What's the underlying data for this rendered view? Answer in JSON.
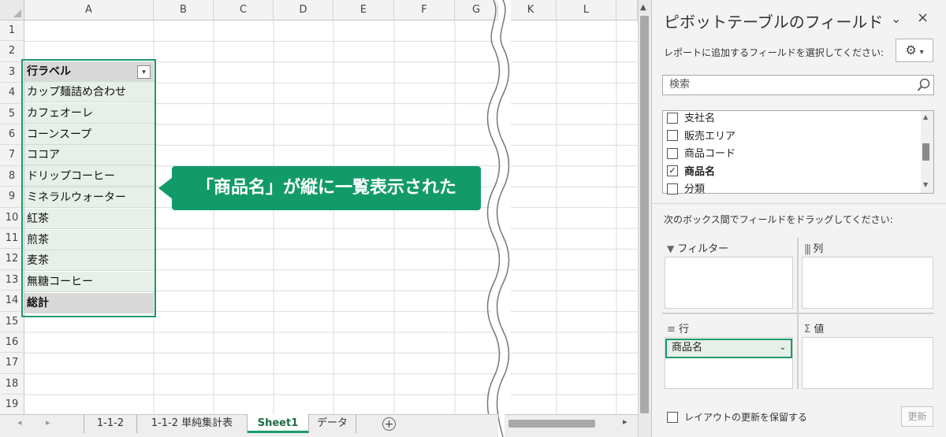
{
  "spreadsheet": {
    "columns": [
      "A",
      "B",
      "C",
      "D",
      "E",
      "F",
      "G",
      "K",
      "L"
    ],
    "rows": [
      "1",
      "2",
      "3",
      "4",
      "5",
      "6",
      "7",
      "8",
      "9",
      "10",
      "11",
      "12",
      "13",
      "14",
      "15",
      "16",
      "17",
      "18",
      "19"
    ],
    "pivot": {
      "header": "行ラベル",
      "items": [
        "カップ麺詰め合わせ",
        "カフェオーレ",
        "コーンスープ",
        "ココア",
        "ドリップコーヒー",
        "ミネラルウォーター",
        "紅茶",
        "煎茶",
        "麦茶",
        "無糖コーヒー"
      ],
      "total": "総計"
    },
    "callout": "「商品名」が縦に一覧表示された"
  },
  "sheet_tabs": {
    "tabs": [
      "1-1-2",
      "1-1-2 単純集計表",
      "Sheet1",
      "データ"
    ],
    "active": "Sheet1",
    "add_icon": "plus-circle-icon"
  },
  "pane": {
    "title": "ピボットテーブルのフィールド",
    "subtitle": "レポートに追加するフィールドを選択してください:",
    "search_placeholder": "検索",
    "fields": [
      {
        "label": "支社名",
        "checked": false
      },
      {
        "label": "販売エリア",
        "checked": false
      },
      {
        "label": "商品コード",
        "checked": false
      },
      {
        "label": "商品名",
        "checked": true
      },
      {
        "label": "分類",
        "checked": false
      }
    ],
    "drag_label": "次のボックス間でフィールドをドラッグしてください:",
    "areas": {
      "filter": "フィルター",
      "columns": "列",
      "rows": "行",
      "values": "値"
    },
    "rows_chip": "商品名",
    "defer_label": "レイアウトの更新を保留する",
    "update_button": "更新"
  },
  "colors": {
    "accent": "#1d9a6c",
    "callout": "#129b69",
    "pivot_fill": "#e6efe8"
  }
}
